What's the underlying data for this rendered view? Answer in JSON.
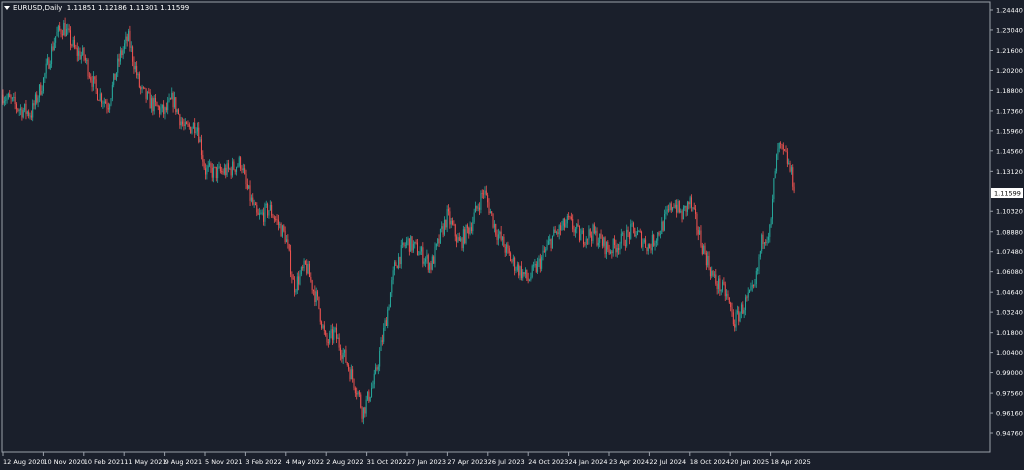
{
  "header": {
    "symbol": "EURUSD,Daily",
    "ohlc": "1.11851 1.12186 1.11301 1.11599"
  },
  "colors": {
    "background": "#1a1f2b",
    "bull": "#26a69a",
    "bear": "#ef5350",
    "axis": "#9aa0aa",
    "price_tag_bg": "#ffffff",
    "price_tag_fg": "#000000"
  },
  "chart_data": {
    "type": "candlestick",
    "title": "EURUSD,Daily",
    "xlabel": "",
    "ylabel": "",
    "ylim": [
      0.9476,
      1.2444
    ],
    "grid": false,
    "current_price": "1.11599",
    "y_ticks": [
      "1.24440",
      "1.23040",
      "1.21600",
      "1.20200",
      "1.18800",
      "1.17360",
      "1.15960",
      "1.14560",
      "1.13120",
      "1.10320",
      "1.08880",
      "1.07480",
      "1.06080",
      "1.04640",
      "1.03240",
      "1.01800",
      "1.00400",
      "0.99000",
      "0.97560",
      "0.96160",
      "0.94760"
    ],
    "x_ticks": [
      "12 Aug 2020",
      "10 Nov 2020",
      "10 Feb 2021",
      "11 May 2021",
      "9 Aug 2021",
      "5 Nov 2021",
      "3 Feb 2022",
      "4 May 2022",
      "2 Aug 2022",
      "31 Oct 2022",
      "27 Jan 2023",
      "27 Apr 2023",
      "26 Jul 2023",
      "24 Oct 2023",
      "24 Jan 2024",
      "23 Apr 2024",
      "22 Jul 2024",
      "18 Oct 2024",
      "20 Jan 2025",
      "18 Apr 2025"
    ],
    "keyframes": [
      {
        "x": 0.0,
        "y": 1.185
      },
      {
        "x": 0.4,
        "y": 1.175
      },
      {
        "x": 0.7,
        "y": 1.172
      },
      {
        "x": 1.0,
        "y": 1.195
      },
      {
        "x": 1.3,
        "y": 1.226
      },
      {
        "x": 1.5,
        "y": 1.233
      },
      {
        "x": 1.8,
        "y": 1.215
      },
      {
        "x": 2.0,
        "y": 1.212
      },
      {
        "x": 2.3,
        "y": 1.188
      },
      {
        "x": 2.6,
        "y": 1.178
      },
      {
        "x": 2.9,
        "y": 1.212
      },
      {
        "x": 3.1,
        "y": 1.225
      },
      {
        "x": 3.4,
        "y": 1.188
      },
      {
        "x": 3.7,
        "y": 1.178
      },
      {
        "x": 4.0,
        "y": 1.172
      },
      {
        "x": 4.2,
        "y": 1.182
      },
      {
        "x": 4.5,
        "y": 1.16
      },
      {
        "x": 4.8,
        "y": 1.165
      },
      {
        "x": 5.0,
        "y": 1.132
      },
      {
        "x": 5.3,
        "y": 1.13
      },
      {
        "x": 5.6,
        "y": 1.132
      },
      {
        "x": 5.9,
        "y": 1.138
      },
      {
        "x": 6.0,
        "y": 1.122
      },
      {
        "x": 6.3,
        "y": 1.098
      },
      {
        "x": 6.6,
        "y": 1.105
      },
      {
        "x": 7.0,
        "y": 1.085
      },
      {
        "x": 7.2,
        "y": 1.05
      },
      {
        "x": 7.5,
        "y": 1.065
      },
      {
        "x": 7.8,
        "y": 1.038
      },
      {
        "x": 8.0,
        "y": 1.01
      },
      {
        "x": 8.2,
        "y": 1.018
      },
      {
        "x": 8.5,
        "y": 0.998
      },
      {
        "x": 8.8,
        "y": 0.975
      },
      {
        "x": 8.9,
        "y": 0.962
      },
      {
        "x": 9.2,
        "y": 0.985
      },
      {
        "x": 9.5,
        "y": 1.03
      },
      {
        "x": 9.7,
        "y": 1.065
      },
      {
        "x": 10.0,
        "y": 1.082
      },
      {
        "x": 10.3,
        "y": 1.075
      },
      {
        "x": 10.6,
        "y": 1.065
      },
      {
        "x": 10.9,
        "y": 1.092
      },
      {
        "x": 11.0,
        "y": 1.1
      },
      {
        "x": 11.3,
        "y": 1.08
      },
      {
        "x": 11.6,
        "y": 1.095
      },
      {
        "x": 11.9,
        "y": 1.118
      },
      {
        "x": 12.2,
        "y": 1.09
      },
      {
        "x": 12.6,
        "y": 1.068
      },
      {
        "x": 13.0,
        "y": 1.055
      },
      {
        "x": 13.3,
        "y": 1.068
      },
      {
        "x": 13.6,
        "y": 1.085
      },
      {
        "x": 14.0,
        "y": 1.096
      },
      {
        "x": 14.3,
        "y": 1.085
      },
      {
        "x": 14.6,
        "y": 1.088
      },
      {
        "x": 15.0,
        "y": 1.076
      },
      {
        "x": 15.3,
        "y": 1.082
      },
      {
        "x": 15.6,
        "y": 1.09
      },
      {
        "x": 16.0,
        "y": 1.078
      },
      {
        "x": 16.3,
        "y": 1.092
      },
      {
        "x": 16.6,
        "y": 1.11
      },
      {
        "x": 16.8,
        "y": 1.1
      },
      {
        "x": 17.0,
        "y": 1.11
      },
      {
        "x": 17.3,
        "y": 1.08
      },
      {
        "x": 17.6,
        "y": 1.055
      },
      {
        "x": 17.9,
        "y": 1.045
      },
      {
        "x": 18.1,
        "y": 1.025
      },
      {
        "x": 18.4,
        "y": 1.04
      },
      {
        "x": 18.6,
        "y": 1.048
      },
      {
        "x": 18.8,
        "y": 1.085
      },
      {
        "x": 19.0,
        "y": 1.09
      },
      {
        "x": 19.1,
        "y": 1.13
      },
      {
        "x": 19.2,
        "y": 1.148
      },
      {
        "x": 19.4,
        "y": 1.14
      },
      {
        "x": 19.6,
        "y": 1.12
      }
    ]
  }
}
